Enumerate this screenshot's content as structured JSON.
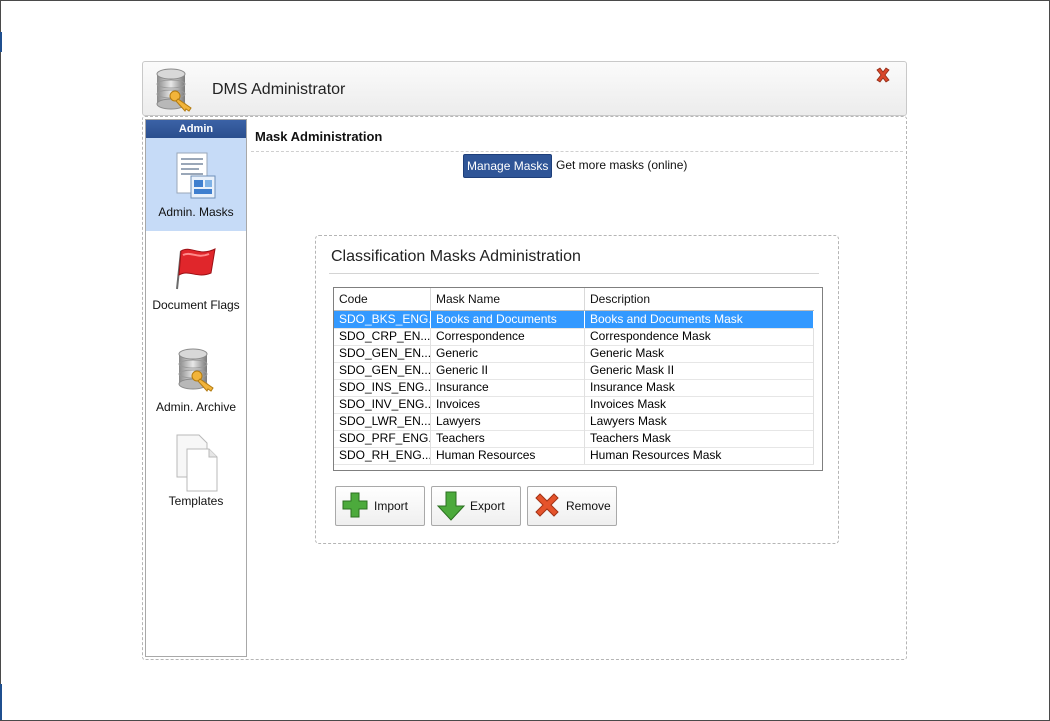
{
  "window": {
    "title": "DMS Administrator"
  },
  "sidebar": {
    "header": "Admin",
    "items": [
      {
        "label": "Admin. Masks",
        "icon": "document-masks-icon",
        "active": true
      },
      {
        "label": "Document Flags",
        "icon": "red-flag-icon",
        "active": false
      },
      {
        "label": "Admin. Archive",
        "icon": "database-key-icon",
        "active": false
      },
      {
        "label": "Templates",
        "icon": "templates-pages-icon",
        "active": false
      }
    ]
  },
  "main": {
    "title": "Mask Administration",
    "tabs": [
      {
        "label": "Manage Masks",
        "selected": true
      },
      {
        "label": "Get more masks (online)",
        "selected": false
      }
    ]
  },
  "panel": {
    "title": "Classification Masks Administration",
    "table": {
      "columns": [
        "Code",
        "Mask Name",
        "Description"
      ],
      "rows": [
        [
          "SDO_BKS_ENG...",
          "Books and Documents",
          "Books and Documents Mask"
        ],
        [
          "SDO_CRP_EN...",
          "Correspondence",
          "Correspondence Mask"
        ],
        [
          "SDO_GEN_EN...",
          "Generic",
          "Generic Mask"
        ],
        [
          "SDO_GEN_EN...",
          "Generic II",
          "Generic Mask II"
        ],
        [
          "SDO_INS_ENG...",
          "Insurance",
          "Insurance Mask"
        ],
        [
          "SDO_INV_ENG...",
          "Invoices",
          "Invoices Mask"
        ],
        [
          "SDO_LWR_EN...",
          "Lawyers",
          "Lawyers Mask"
        ],
        [
          "SDO_PRF_ENG...",
          "Teachers",
          "Teachers Mask"
        ],
        [
          "SDO_RH_ENG...",
          "Human Resources",
          "Human Resources Mask"
        ]
      ],
      "selected_row": 0
    },
    "buttons": {
      "import": "Import",
      "export": "Export",
      "remove": "Remove"
    }
  },
  "colors": {
    "accent": "#2f5597",
    "selection": "#3399ff",
    "sidebar_active": "#c6dbf7"
  }
}
